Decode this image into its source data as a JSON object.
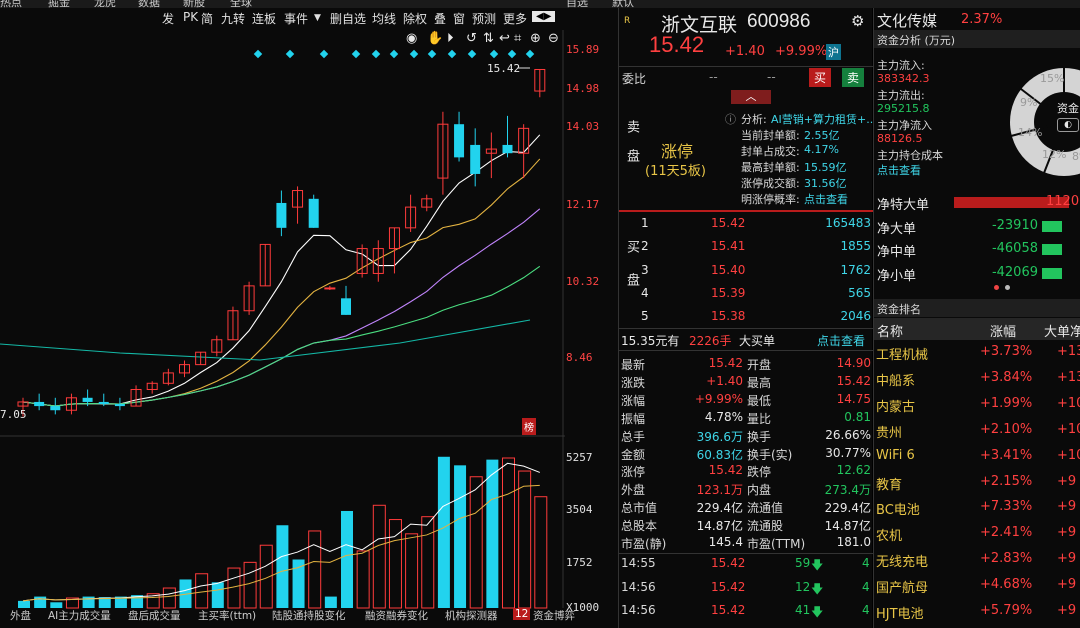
{
  "top_menu": [
    "热点",
    "掘金",
    "龙虎",
    "数据",
    "新股",
    "全球",
    "自选",
    "默认"
  ],
  "toolbar": [
    "发",
    "PK",
    "简",
    "九转",
    "连板",
    "事件",
    "删自选",
    "均线",
    "除权",
    "叠",
    "窗",
    "预测",
    "更多"
  ],
  "chart": {
    "price_labels": [
      "15.89",
      "14.98",
      "14.03",
      "12.17",
      "10.32",
      "8.46"
    ],
    "last_price_tag": "15.42",
    "low_label": "7.05",
    "badge": "榜",
    "volume_labels": [
      "5257",
      "3504",
      "1752"
    ],
    "volume_unit": "X1000"
  },
  "chart_data": {
    "type": "candlestick",
    "ohlc": [
      {
        "o": 7.3,
        "h": 7.5,
        "l": 7.05,
        "c": 7.4
      },
      {
        "o": 7.4,
        "h": 7.6,
        "l": 7.2,
        "c": 7.3
      },
      {
        "o": 7.3,
        "h": 7.5,
        "l": 7.1,
        "c": 7.2
      },
      {
        "o": 7.2,
        "h": 7.6,
        "l": 7.1,
        "c": 7.5
      },
      {
        "o": 7.5,
        "h": 7.7,
        "l": 7.3,
        "c": 7.4
      },
      {
        "o": 7.4,
        "h": 7.6,
        "l": 7.3,
        "c": 7.35
      },
      {
        "o": 7.35,
        "h": 7.5,
        "l": 7.2,
        "c": 7.3
      },
      {
        "o": 7.3,
        "h": 7.8,
        "l": 7.3,
        "c": 7.7
      },
      {
        "o": 7.7,
        "h": 7.9,
        "l": 7.6,
        "c": 7.85
      },
      {
        "o": 7.85,
        "h": 8.2,
        "l": 7.8,
        "c": 8.1
      },
      {
        "o": 8.1,
        "h": 8.4,
        "l": 8.0,
        "c": 8.3
      },
      {
        "o": 8.3,
        "h": 8.6,
        "l": 8.3,
        "c": 8.6
      },
      {
        "o": 8.6,
        "h": 9.0,
        "l": 8.5,
        "c": 8.9
      },
      {
        "o": 8.9,
        "h": 9.7,
        "l": 8.9,
        "c": 9.6
      },
      {
        "o": 9.6,
        "h": 10.3,
        "l": 9.5,
        "c": 10.2
      },
      {
        "o": 10.2,
        "h": 11.2,
        "l": 10.2,
        "c": 11.2
      },
      {
        "o": 12.2,
        "h": 12.5,
        "l": 11.4,
        "c": 11.6
      },
      {
        "o": 12.1,
        "h": 12.6,
        "l": 11.7,
        "c": 12.5
      },
      {
        "o": 12.3,
        "h": 12.4,
        "l": 11.6,
        "c": 11.6
      },
      {
        "o": 10.15,
        "h": 10.2,
        "l": 10.1,
        "c": 10.15
      },
      {
        "o": 9.9,
        "h": 10.2,
        "l": 9.5,
        "c": 9.5
      },
      {
        "o": 10.5,
        "h": 11.2,
        "l": 10.4,
        "c": 11.1
      },
      {
        "o": 10.5,
        "h": 11.3,
        "l": 10.3,
        "c": 11.1
      },
      {
        "o": 11.1,
        "h": 11.6,
        "l": 10.5,
        "c": 11.6
      },
      {
        "o": 11.6,
        "h": 12.4,
        "l": 11.5,
        "c": 12.1
      },
      {
        "o": 12.1,
        "h": 12.4,
        "l": 12.0,
        "c": 12.3
      },
      {
        "o": 12.8,
        "h": 14.4,
        "l": 12.4,
        "c": 14.1
      },
      {
        "o": 14.1,
        "h": 14.4,
        "l": 13.2,
        "c": 13.3
      },
      {
        "o": 13.6,
        "h": 14.0,
        "l": 12.6,
        "c": 12.9
      },
      {
        "o": 13.4,
        "h": 13.9,
        "l": 12.8,
        "c": 13.5
      },
      {
        "o": 13.6,
        "h": 14.3,
        "l": 13.3,
        "c": 13.4
      },
      {
        "o": 13.4,
        "h": 14.1,
        "l": 12.8,
        "c": 14.0
      },
      {
        "o": 14.9,
        "h": 15.42,
        "l": 14.75,
        "c": 15.42
      }
    ],
    "volume": [
      {
        "v": 250,
        "dir": "down"
      },
      {
        "v": 400,
        "dir": "down"
      },
      {
        "v": 200,
        "dir": "down"
      },
      {
        "v": 350,
        "dir": "up"
      },
      {
        "v": 400,
        "dir": "down"
      },
      {
        "v": 380,
        "dir": "down"
      },
      {
        "v": 400,
        "dir": "down"
      },
      {
        "v": 450,
        "dir": "down"
      },
      {
        "v": 500,
        "dir": "up"
      },
      {
        "v": 700,
        "dir": "up"
      },
      {
        "v": 1000,
        "dir": "down"
      },
      {
        "v": 1200,
        "dir": "up"
      },
      {
        "v": 900,
        "dir": "down"
      },
      {
        "v": 1400,
        "dir": "up"
      },
      {
        "v": 1600,
        "dir": "up"
      },
      {
        "v": 2200,
        "dir": "up"
      },
      {
        "v": 2900,
        "dir": "down"
      },
      {
        "v": 1700,
        "dir": "down"
      },
      {
        "v": 2700,
        "dir": "up"
      },
      {
        "v": 400,
        "dir": "down"
      },
      {
        "v": 3400,
        "dir": "down"
      },
      {
        "v": 2000,
        "dir": "up"
      },
      {
        "v": 3600,
        "dir": "up"
      },
      {
        "v": 3100,
        "dir": "up"
      },
      {
        "v": 2600,
        "dir": "up"
      },
      {
        "v": 3200,
        "dir": "up"
      },
      {
        "v": 5300,
        "dir": "down"
      },
      {
        "v": 5000,
        "dir": "down"
      },
      {
        "v": 4600,
        "dir": "up"
      },
      {
        "v": 5200,
        "dir": "down"
      },
      {
        "v": 5257,
        "dir": "up"
      },
      {
        "v": 4800,
        "dir": "up"
      },
      {
        "v": 3900,
        "dir": "up"
      }
    ],
    "price_axis": [
      7.05,
      15.89
    ],
    "volume_axis": [
      0,
      5257
    ]
  },
  "bottom_tabs": [
    "外盘",
    "AI主力成交量",
    "盘后成交量",
    "主买率(ttm)",
    "陆股通持股变化",
    "融资融券变化",
    "机构探测器",
    "资金博弈"
  ],
  "bottom_tab_badge": "12",
  "stock": {
    "name": "浙文互联",
    "code": "600986",
    "price": "15.42",
    "change": "+1.40",
    "change_pct": "+9.99%",
    "exchange_badge": "沪",
    "r_badge": "R"
  },
  "weibi": {
    "label": "委比",
    "v1": "--",
    "v2": "--",
    "buy_btn": "买",
    "sell_btn": "卖"
  },
  "limit_up": {
    "sell_label": "卖盘",
    "status": "涨停",
    "sub": "(11天5板)",
    "analysis_label": "分析:",
    "analysis_text": "AI营销+算力租赁+...",
    "rows": [
      {
        "k": "当前封单额:",
        "v": "2.55亿"
      },
      {
        "k": "封单占成交:",
        "v": "4.17%"
      },
      {
        "k": "最高封单额:",
        "v": "15.59亿"
      },
      {
        "k": "涨停成交额:",
        "v": "31.56亿"
      },
      {
        "k": "明涨停概率:",
        "v": "点击查看"
      }
    ]
  },
  "bids": [
    {
      "n": "1",
      "p": "15.42",
      "q": "165483"
    },
    {
      "n": "2",
      "p": "15.41",
      "q": "1855"
    },
    {
      "n": "3",
      "p": "15.40",
      "q": "1762"
    },
    {
      "n": "4",
      "p": "15.39",
      "q": "565"
    },
    {
      "n": "5",
      "p": "15.38",
      "q": "2046"
    }
  ],
  "buy_label": "买盘",
  "big_order": {
    "price": "15.35元有",
    "qty": "2226手",
    "label": "大买单",
    "link": "点击查看"
  },
  "quote": [
    {
      "k1": "最新",
      "v1": "15.42",
      "c1": "red",
      "k2": "开盘",
      "v2": "14.90",
      "c2": "red"
    },
    {
      "k1": "涨跌",
      "v1": "+1.40",
      "c1": "red",
      "k2": "最高",
      "v2": "15.42",
      "c2": "red"
    },
    {
      "k1": "涨幅",
      "v1": "+9.99%",
      "c1": "red",
      "k2": "最低",
      "v2": "14.75",
      "c2": "red"
    },
    {
      "k1": "振幅",
      "v1": "4.78%",
      "c1": "white",
      "k2": "量比",
      "v2": "0.81",
      "c2": "green"
    },
    {
      "k1": "总手",
      "v1": "396.6万",
      "c1": "cyan",
      "k2": "换手",
      "v2": "26.66%",
      "c2": "white"
    },
    {
      "k1": "金额",
      "v1": "60.83亿",
      "c1": "cyan",
      "k2": "换手(实)",
      "v2": "30.77%",
      "c2": "white"
    },
    {
      "k1": "涨停",
      "v1": "15.42",
      "c1": "red",
      "k2": "跌停",
      "v2": "12.62",
      "c2": "green"
    },
    {
      "k1": "外盘",
      "v1": "123.1万",
      "c1": "red",
      "k2": "内盘",
      "v2": "273.4万",
      "c2": "green"
    },
    {
      "k1": "总市值",
      "v1": "229.4亿",
      "c1": "white",
      "k2": "流通值",
      "v2": "229.4亿",
      "c2": "white"
    },
    {
      "k1": "总股本",
      "v1": "14.87亿",
      "c1": "white",
      "k2": "流通股",
      "v2": "14.87亿",
      "c2": "white"
    },
    {
      "k1": "市盈(静)",
      "v1": "145.4",
      "c1": "white",
      "k2": "市盈(TTM)",
      "v2": "181.0",
      "c2": "white"
    }
  ],
  "ticks": [
    {
      "t": "14:55",
      "p": "15.42",
      "q": "59",
      "n": "4"
    },
    {
      "t": "14:56",
      "p": "15.42",
      "q": "12",
      "n": "4"
    },
    {
      "t": "14:56",
      "p": "15.42",
      "q": "41",
      "n": "4"
    }
  ],
  "sector": {
    "name": "文化传媒",
    "pct": "2.37%"
  },
  "fund_analysis": {
    "title": "资金分析 (万元)",
    "rows": [
      {
        "k": "主力流入:",
        "v": "383342.3",
        "c": "red"
      },
      {
        "k": "主力流出:",
        "v": "295215.8",
        "c": "green"
      },
      {
        "k": "主力净流入",
        "v": "88126.5",
        "c": "red"
      },
      {
        "k": "主力持仓成本",
        "v": "",
        "c": "white"
      },
      {
        "k": "点击查看",
        "v": "",
        "c": "cyan"
      }
    ],
    "pie_labels": [
      "15%",
      "9%",
      "14%",
      "12%",
      "8%"
    ],
    "pie_center": "资金"
  },
  "net_flows": [
    {
      "k": "净特大单",
      "v": "1120",
      "c": "red",
      "bar": "red"
    },
    {
      "k": "净大单",
      "v": "-23910",
      "c": "green",
      "bar": "green"
    },
    {
      "k": "净中单",
      "v": "-46058",
      "c": "green",
      "bar": "green"
    },
    {
      "k": "净小单",
      "v": "-42069",
      "c": "green",
      "bar": "green"
    }
  ],
  "ranking": {
    "title": "资金排名",
    "headers": [
      "名称",
      "涨幅",
      "大单净"
    ],
    "rows": [
      {
        "name": "工程机械",
        "pct": "+3.73%",
        "net": "+13"
      },
      {
        "name": "中船系",
        "pct": "+3.84%",
        "net": "+13"
      },
      {
        "name": "内蒙古",
        "pct": "+1.99%",
        "net": "+10"
      },
      {
        "name": "贵州",
        "pct": "+2.10%",
        "net": "+10"
      },
      {
        "name": "WiFi 6",
        "pct": "+3.41%",
        "net": "+10"
      },
      {
        "name": "教育",
        "pct": "+2.15%",
        "net": "+9"
      },
      {
        "name": "BC电池",
        "pct": "+7.33%",
        "net": "+9"
      },
      {
        "name": "农机",
        "pct": "+2.41%",
        "net": "+9"
      },
      {
        "name": "无线充电",
        "pct": "+2.83%",
        "net": "+9"
      },
      {
        "name": "国产航母",
        "pct": "+4.68%",
        "net": "+9"
      },
      {
        "name": "HJT电池",
        "pct": "+5.79%",
        "net": "+9"
      }
    ]
  },
  "colors": {
    "up": "#ff3b3b",
    "down": "#22d3ee",
    "ma5": "#ffffff",
    "ma10": "#e3b341",
    "ma20": "#c084fc",
    "ma30": "#4ade80",
    "ma60": "#14b8a6"
  }
}
